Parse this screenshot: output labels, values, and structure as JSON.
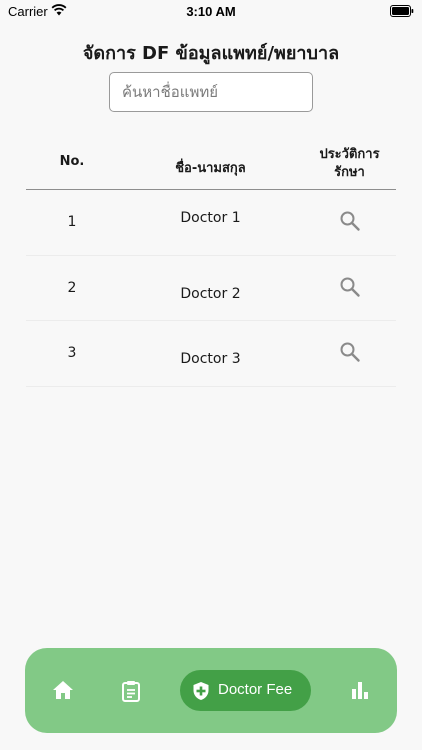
{
  "status_bar": {
    "carrier": "Carrier",
    "time": "3:10 AM",
    "icons": [
      "wifi-icon",
      "battery-icon"
    ]
  },
  "page": {
    "title": "จัดการ DF ข้อมูลแพทย์/พยาบาล"
  },
  "search": {
    "placeholder": "ค้นหาชื่อแพทย์",
    "value": ""
  },
  "table": {
    "headers": {
      "no": "No.",
      "name": "ชื่อ-นามสกุล",
      "history_line1": "ประวัติการ",
      "history_line2": "รักษา"
    },
    "rows": [
      {
        "no": "1",
        "name": "Doctor 1",
        "action_icon": "search-icon"
      },
      {
        "no": "2",
        "name": "Doctor 2",
        "action_icon": "search-icon"
      },
      {
        "no": "3",
        "name": "Doctor 3",
        "action_icon": "search-icon"
      }
    ]
  },
  "bottom_nav": {
    "items": [
      {
        "icon": "home-icon"
      },
      {
        "icon": "clipboard-icon"
      },
      {
        "icon": "shield-plus-icon",
        "label": "Doctor Fee",
        "active": true
      },
      {
        "icon": "bar-chart-icon"
      }
    ],
    "colors": {
      "bar": "#82c986",
      "active": "#43a047"
    }
  }
}
